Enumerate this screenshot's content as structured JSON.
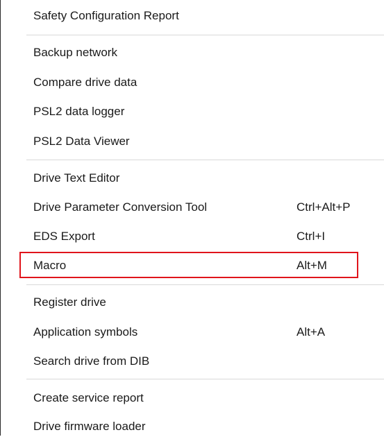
{
  "menu": {
    "groups": [
      {
        "items": [
          {
            "label": "Safety Configuration Report",
            "shortcut": ""
          }
        ]
      },
      {
        "items": [
          {
            "label": "Backup network",
            "shortcut": ""
          },
          {
            "label": "Compare drive data",
            "shortcut": ""
          },
          {
            "label": "PSL2 data logger",
            "shortcut": ""
          },
          {
            "label": "PSL2 Data Viewer",
            "shortcut": ""
          }
        ]
      },
      {
        "items": [
          {
            "label": "Drive Text Editor",
            "shortcut": ""
          },
          {
            "label": "Drive Parameter Conversion Tool",
            "shortcut": "Ctrl+Alt+P"
          },
          {
            "label": "EDS Export",
            "shortcut": "Ctrl+I"
          },
          {
            "label": "Macro",
            "shortcut": "Alt+M"
          }
        ]
      },
      {
        "items": [
          {
            "label": "Register drive",
            "shortcut": ""
          },
          {
            "label": "Application symbols",
            "shortcut": "Alt+A"
          },
          {
            "label": "Search drive from DIB",
            "shortcut": ""
          }
        ]
      },
      {
        "items": [
          {
            "label": "Create service report",
            "shortcut": ""
          },
          {
            "label": "Drive firmware loader",
            "shortcut": ""
          }
        ]
      }
    ],
    "highlighted_item": "Macro",
    "highlight_color": "#e0141b",
    "separator_color": "#d9d9d9"
  }
}
